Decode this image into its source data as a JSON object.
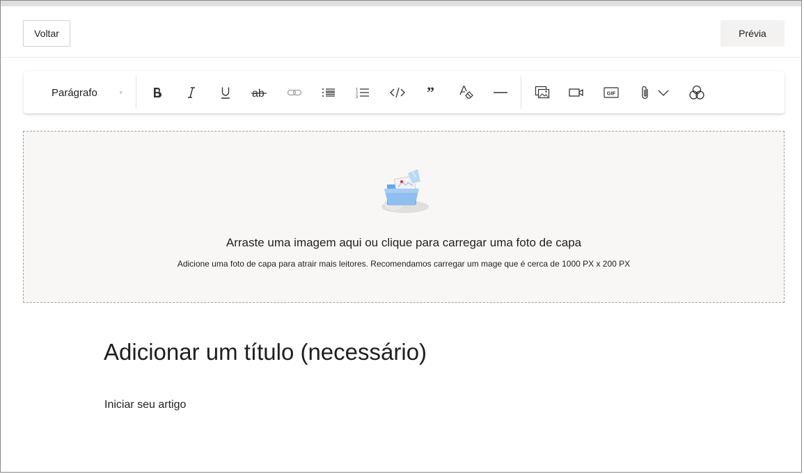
{
  "header": {
    "back_label": "Voltar",
    "preview_label": "Prévia"
  },
  "toolbar": {
    "paragraph_style": "Parágrafo",
    "buttons": [
      {
        "name": "bold",
        "icon": "bold-icon"
      },
      {
        "name": "italic",
        "icon": "italic-icon"
      },
      {
        "name": "underline",
        "icon": "underline-icon"
      },
      {
        "name": "strikethrough",
        "icon": "strikethrough-icon"
      },
      {
        "name": "link",
        "icon": "link-icon",
        "disabled": true
      },
      {
        "name": "bulleted-list",
        "icon": "bulleted-list-icon"
      },
      {
        "name": "numbered-list",
        "icon": "numbered-list-icon"
      },
      {
        "name": "code",
        "icon": "code-icon"
      },
      {
        "name": "quote",
        "icon": "quote-icon"
      },
      {
        "name": "clear-formatting",
        "icon": "clear-formatting-icon"
      },
      {
        "name": "horizontal-rule",
        "icon": "horizontal-rule-icon"
      },
      {
        "name": "insert-image",
        "icon": "image-icon"
      },
      {
        "name": "insert-video",
        "icon": "video-icon"
      },
      {
        "name": "insert-gif",
        "icon": "gif-icon",
        "label": "GIF"
      },
      {
        "name": "attachment",
        "icon": "paperclip-icon"
      },
      {
        "name": "attachment-dropdown",
        "icon": "chevron-down-icon"
      },
      {
        "name": "more-embeds",
        "icon": "shapes-icon"
      }
    ]
  },
  "cover": {
    "title": "Arraste uma imagem aqui ou clique para carregar uma foto de capa",
    "subtitle": "Adicione uma foto de capa para atrair mais leitores. Recomendamos carregar um mage que é cerca de 1000 PX x 200 PX",
    "illustration": "folder-upload-illustration"
  },
  "article": {
    "title_placeholder": "Adicionar um título (necessário)",
    "body_placeholder": "Iniciar seu artigo"
  },
  "colors": {
    "border": "#8a8886",
    "cover_bg": "#f8f7f5",
    "preview_bg": "#f3f2f1",
    "text": "#201f1e",
    "icon": "#323130",
    "disabled_icon": "#a19f9d"
  }
}
